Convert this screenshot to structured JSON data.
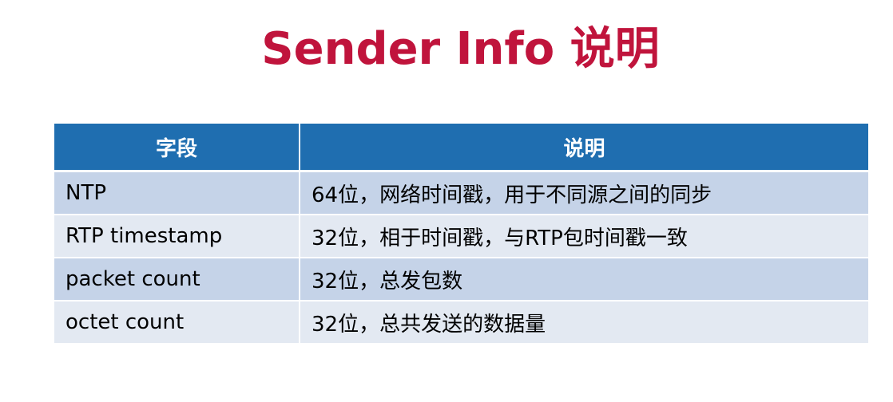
{
  "title": "Sender Info 说明",
  "table": {
    "headers": [
      "字段",
      "说明"
    ],
    "rows": [
      {
        "field": "NTP",
        "desc": "64位，网络时间戳，用于不同源之间的同步"
      },
      {
        "field": "RTP timestamp",
        "desc": "32位，相于时间戳，与RTP包时间戳一致"
      },
      {
        "field": "packet count",
        "desc": "32位，总发包数"
      },
      {
        "field": "octet count",
        "desc": "32位，总共发送的数据量"
      }
    ]
  }
}
